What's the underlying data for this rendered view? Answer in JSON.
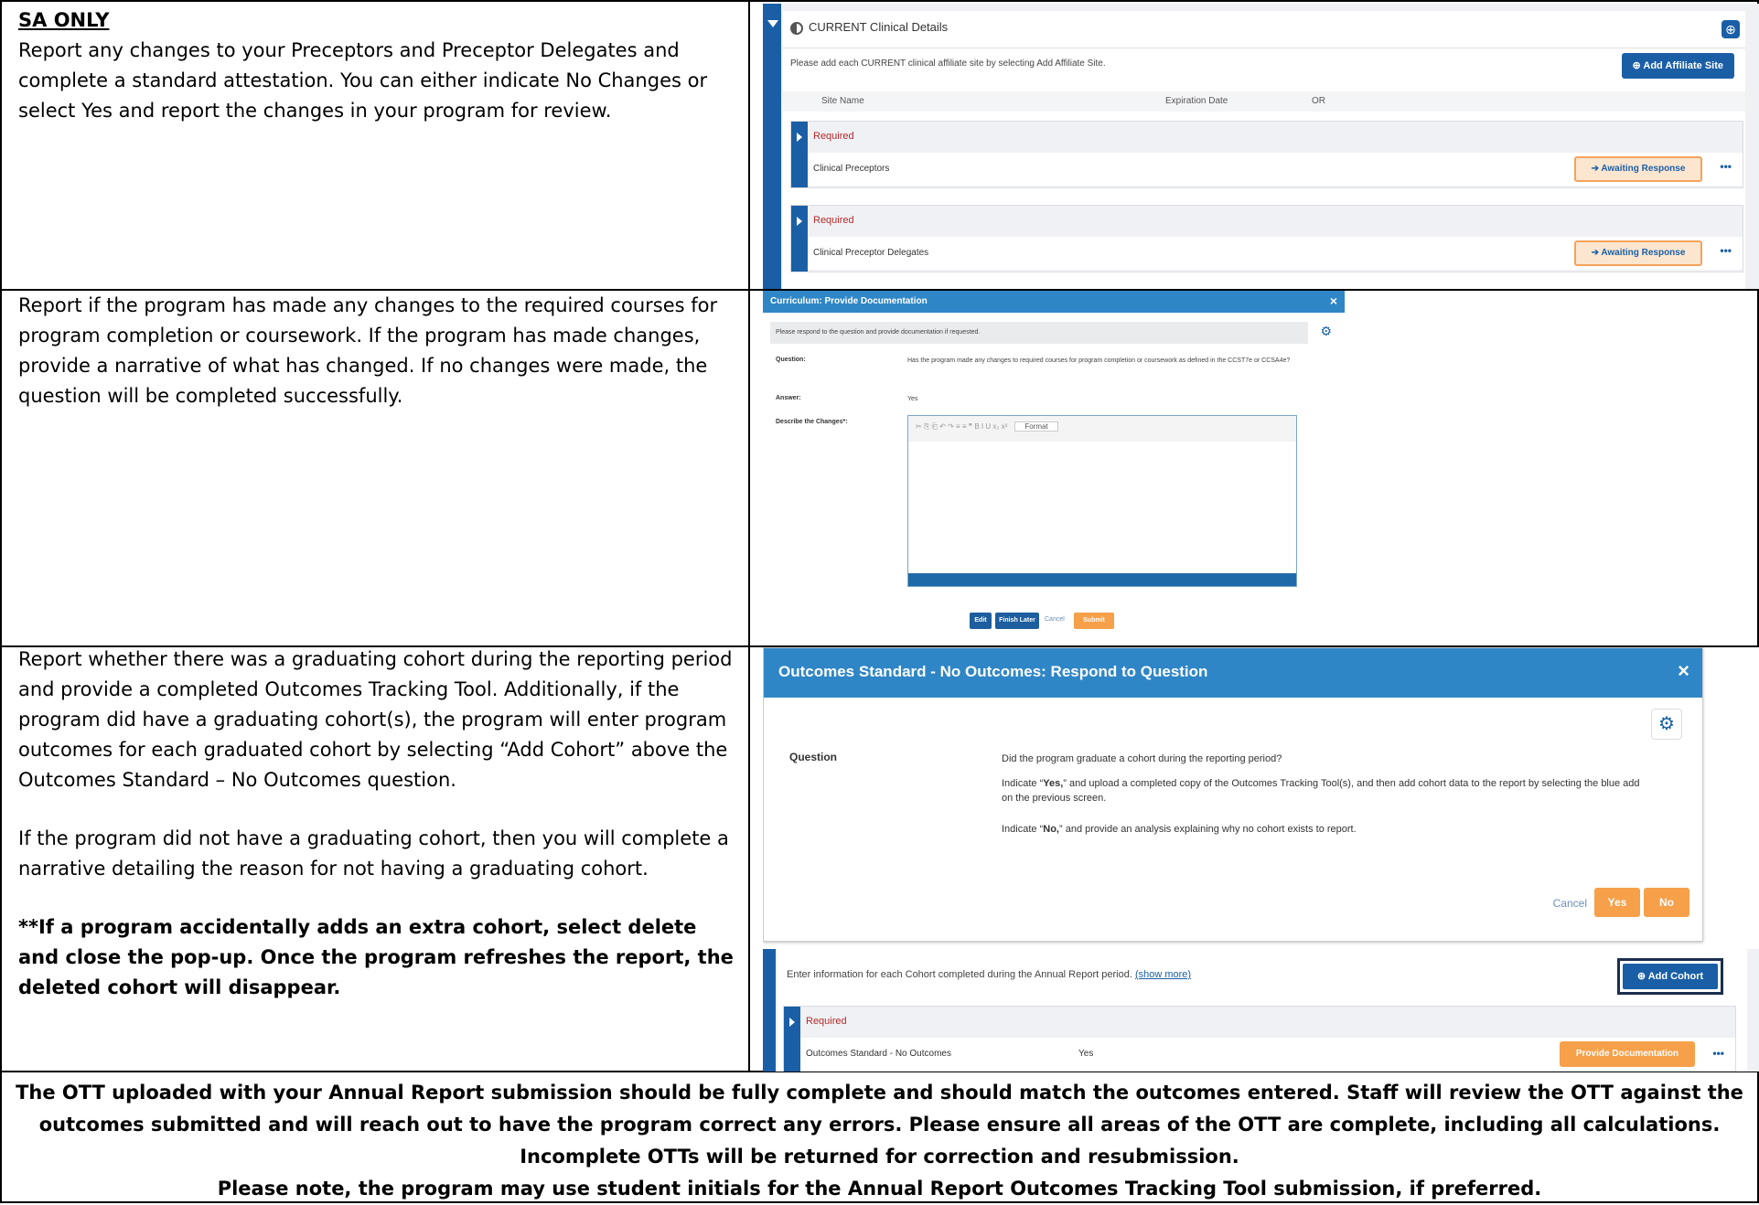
{
  "section1": {
    "heading": "SA ONLY",
    "text": "Report any changes to your Preceptors and Preceptor Delegates and complete a standard attestation.  You can either indicate No Changes or select Yes and report the changes in your program for review."
  },
  "section2": {
    "text": "Report if the program has made any changes to the required courses for program completion or coursework. If the program has made changes, provide a narrative of what has changed. If no changes were made, the question will be completed successfully."
  },
  "section3": {
    "para1": "Report whether there was a graduating cohort during the reporting period and provide a completed Outcomes Tracking Tool. Additionally, if the program did have a graduating cohort(s), the program will enter program outcomes for each graduated cohort by selecting “Add Cohort” above the Outcomes Standard – No Outcomes question.",
    "para2": "If the program did not have a graduating cohort, then you will complete a narrative detailing the reason for not having a graduating cohort.",
    "para3": "**If a program accidentally adds an extra cohort, select delete and close the pop-up. Once the program refreshes the report, the deleted cohort will disappear."
  },
  "footer": {
    "line1": "The OTT uploaded with your Annual Report submission should be fully complete and should match the outcomes entered. Staff will review the OTT against the outcomes submitted and will reach out to have the program correct any errors. Please ensure all areas of the OTT are complete, including all calculations. Incomplete OTTs will be returned for correction and resubmission.",
    "line2": "Please note, the program may use student initials for the Annual Report Outcomes Tracking Tool submission, if preferred."
  },
  "screenshot1": {
    "title": "CURRENT Clinical Details",
    "instruction": "Please add each CURRENT clinical affiliate site by selecting Add Affiliate Site.",
    "add_button": "Add Affiliate Site",
    "columns": [
      "Site Name",
      "Expiration Date",
      "OR"
    ],
    "records": [
      {
        "required": "Required",
        "name": "Clinical Preceptors",
        "status": "Awaiting Response"
      },
      {
        "required": "Required",
        "name": "Clinical Preceptor Delegates",
        "status": "Awaiting Response"
      }
    ],
    "more": "•••",
    "colors": {
      "primary": "#1a5fa6",
      "accent": "#f5a35c",
      "required": "#b32a2a"
    }
  },
  "screenshot2": {
    "title": "Curriculum: Provide Documentation",
    "close": "×",
    "note": "Please respond to the question and provide documentation if requested.",
    "question_label": "Question:",
    "question": "Has the program made any changes to required courses for program completion or coursework as defined in the CCST7e or CCSA4e?",
    "answer_label": "Answer:",
    "answer": "Yes",
    "describe_label": "Describe the Changes*:",
    "format_label": "Format",
    "buttons": {
      "edit": "Edit",
      "finish_later": "Finish Later",
      "cancel": "Cancel",
      "submit": "Submit"
    }
  },
  "screenshot3": {
    "title": "Outcomes Standard - No Outcomes: Respond to Question",
    "close": "×",
    "question_label": "Question",
    "question": "Did the program graduate a cohort during the reporting period?",
    "yes_prefix": "Indicate “",
    "yes_word": "Yes,",
    "yes_rest": "” and upload a completed copy of the Outcomes Tracking Tool(s), and then add cohort data to the report by selecting the blue add on the previous screen.",
    "no_prefix": "Indicate “",
    "no_word": "No,",
    "no_rest": "” and provide an analysis explaining why no cohort exists to report.",
    "cancel": "Cancel",
    "yes": "Yes",
    "no": "No",
    "lower_text": "Enter information for each Cohort completed during the Annual Report period.",
    "show_more": "(show more)",
    "add_cohort": "Add Cohort",
    "required": "Required",
    "row_name": "Outcomes Standard - No Outcomes",
    "row_value": "Yes",
    "provide": "Provide Documentation",
    "more": "•••"
  }
}
